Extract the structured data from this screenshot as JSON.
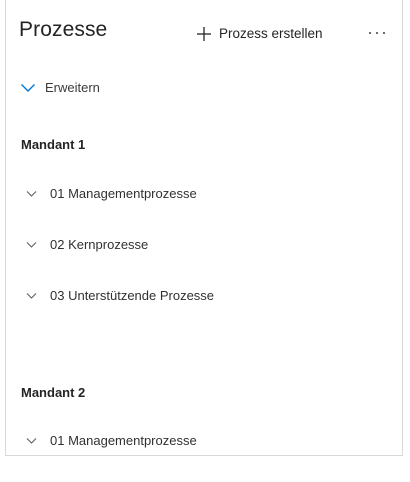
{
  "header": {
    "title": "Prozesse",
    "create_label": "Prozess erstellen",
    "create_icon": "plus-icon",
    "more_icon": "more-horizontal-icon"
  },
  "expand": {
    "label": "Erweitern",
    "icon": "chevron-down-icon",
    "accent": "#0078d4"
  },
  "groups": [
    {
      "title": "Mandant 1",
      "items": [
        {
          "label": "01 Managementprozesse"
        },
        {
          "label": "02 Kernprozesse"
        },
        {
          "label": "03 Unterstützende Prozesse"
        }
      ]
    },
    {
      "title": "Mandant 2",
      "items": [
        {
          "label": "01 Managementprozesse"
        }
      ]
    }
  ]
}
